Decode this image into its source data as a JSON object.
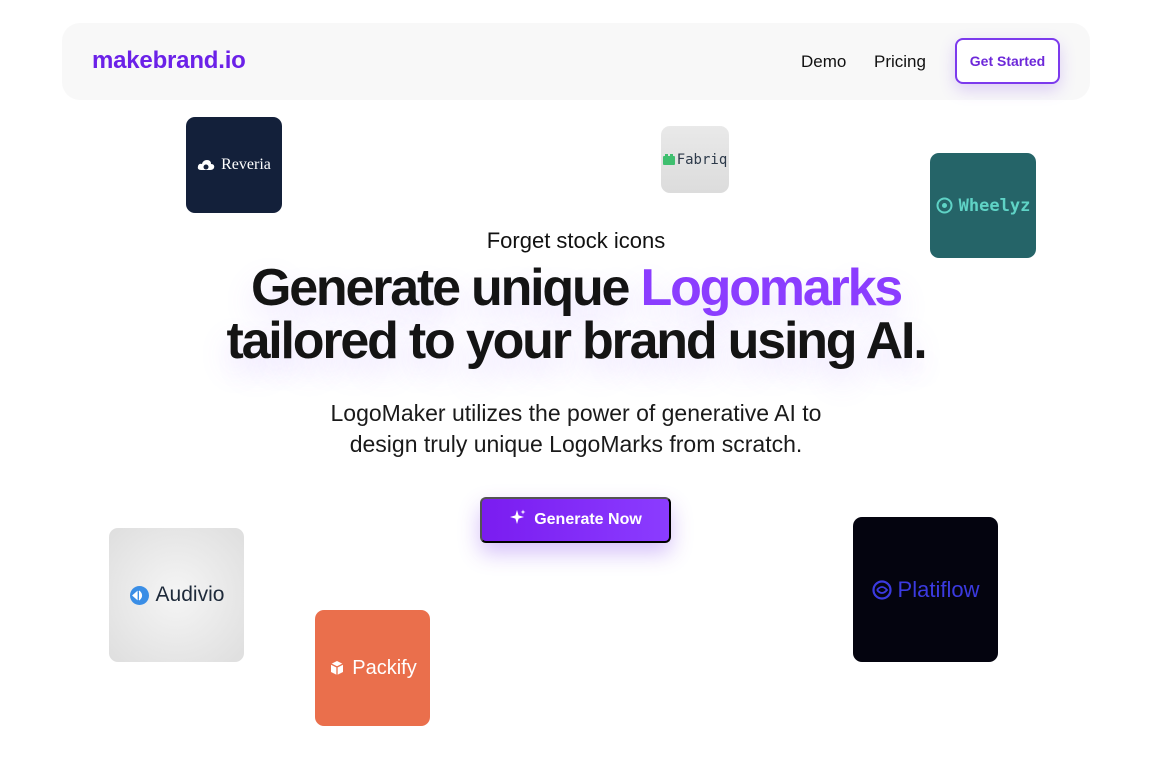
{
  "nav": {
    "brand": "makebrand.io",
    "links": [
      "Demo",
      "Pricing"
    ],
    "cta_label": "Get Started"
  },
  "hero": {
    "eyebrow": "Forget stock icons",
    "headline_part1": "Generate unique ",
    "headline_accent": "Logomarks",
    "headline_part2": "tailored to your brand using AI.",
    "subtext_line1": "LogoMaker utilizes the power of generative AI to",
    "subtext_line2": "design truly unique LogoMarks from scratch.",
    "cta_label": "Generate Now",
    "cta_icon": "sparkle-icon"
  },
  "logos": [
    {
      "name": "Reveria",
      "bg": "#13203a",
      "icon": "cloud-icon"
    },
    {
      "name": "Fabriq",
      "bg": "#e2e2e2",
      "icon": "fabric-icon"
    },
    {
      "name": "Wheelyz",
      "bg": "#256468",
      "icon": "wheel-icon"
    },
    {
      "name": "Audivio",
      "bg": "#e8e8e8",
      "icon": "audio-icon"
    },
    {
      "name": "Packify",
      "bg": "#ea6f4c",
      "icon": "box-icon"
    },
    {
      "name": "Platiflow",
      "bg": "#04040f",
      "icon": "flow-icon"
    }
  ],
  "colors": {
    "accent": "#7c3aed",
    "brand": "#6b21e8"
  }
}
